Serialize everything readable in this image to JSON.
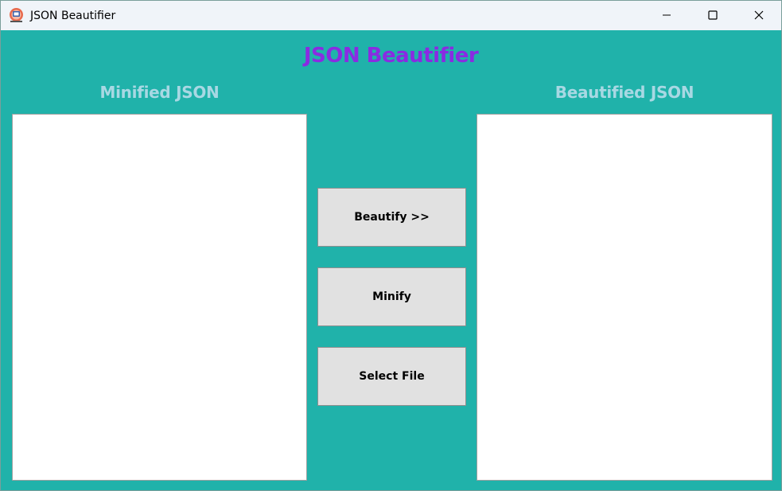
{
  "window": {
    "title": "JSON Beautifier",
    "app_icon": "app-icon",
    "controls": {
      "minimize_icon": "minimize-icon",
      "maximize_icon": "maximize-icon",
      "close_icon": "close-icon"
    }
  },
  "header": {
    "title": "JSON Beautifier",
    "title_color": "#8a2be2"
  },
  "panels": {
    "left_label": "Minified JSON",
    "right_label": "Beautified JSON",
    "left_value": "",
    "right_value": "",
    "label_color": "#a8d8e3"
  },
  "actions": {
    "beautify_label": "Beautify >>",
    "minify_label": "Minify",
    "select_file_label": "Select File"
  },
  "colors": {
    "background": "#20b2aa",
    "titlebar": "#f0f4f9",
    "button": "#e1e1e1"
  }
}
